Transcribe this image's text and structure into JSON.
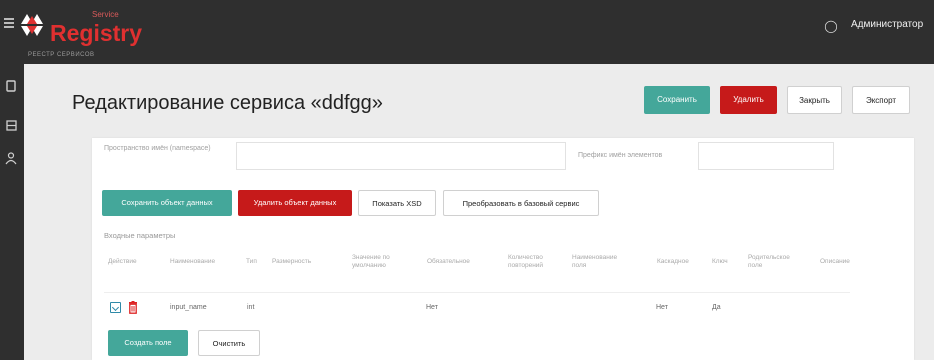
{
  "header": {
    "brand_top": "Service",
    "brand": "Registry",
    "brand_sub": "РЕЕСТР СЕРВИСОВ",
    "user_name": "Администратор"
  },
  "sidebar": {
    "icons": [
      "document-icon",
      "storage-icon",
      "user-icon"
    ]
  },
  "page": {
    "title": "Редактирование сервиса «ddfgg»",
    "buttons": {
      "save": "Сохранить",
      "delete": "Удалить",
      "close": "Закрыть",
      "export": "Экспорт"
    }
  },
  "form": {
    "namespace_label": "Пространство имён (namespace)",
    "namespace_value": "",
    "prefix_label": "Префикс имён элементов",
    "prefix_value": ""
  },
  "data_object_actions": {
    "save": "Сохранить объект данных",
    "delete": "Удалить объект данных",
    "show_xsd": "Показать XSD",
    "convert": "Преобразовать в базовый сервис"
  },
  "input_params": {
    "title": "Входные параметры",
    "headers": [
      "Действие",
      "Наименование",
      "Тип",
      "Размерность",
      "Значение по умолчанию",
      "Обязательное",
      "Количество повторений",
      "Наименование поля",
      "Каскадное",
      "Ключ",
      "Родительское поле",
      "Описание"
    ],
    "rows": [
      {
        "name": "input_name",
        "type": "int",
        "required": "Нет",
        "cascade": "Нет",
        "key": "Да"
      }
    ],
    "create_field": "Создать поле",
    "clear": "Очистить"
  },
  "colors": {
    "accent": "#44a79a",
    "danger": "#c61a1a",
    "topbar": "#2f2f2f",
    "brand": "#e03030"
  }
}
